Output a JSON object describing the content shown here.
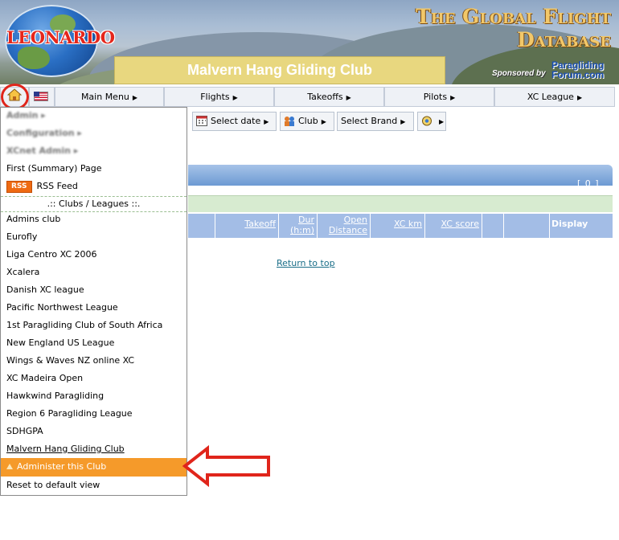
{
  "header": {
    "logo_text": "LEONARDO",
    "db_title": "The Global Flight Database",
    "club_name": "Malvern Hang Gliding Club",
    "sponsored_by": "Sponsored by",
    "sponsor_line1": "Paragliding",
    "sponsor_line2": "Forum.com"
  },
  "menubar": {
    "home_icon": "home-icon",
    "flag_icon": "us-flag-icon",
    "items": [
      {
        "label": "Main Menu"
      },
      {
        "label": "Flights"
      },
      {
        "label": "Takeoffs"
      },
      {
        "label": "Pilots"
      },
      {
        "label": "XC League"
      }
    ]
  },
  "toolbar": {
    "select_date": "Select date",
    "club": "Club",
    "select_brand": "Select Brand"
  },
  "table": {
    "count": "[ 0 ]",
    "columns": [
      "Takeoff",
      "Dur (h:m)",
      "Open Distance",
      "XC km",
      "XC score"
    ],
    "display_label": "Display",
    "return_to_top": "Return to top"
  },
  "dropdown": {
    "blurred": [
      "Admin",
      "Configuration",
      "XCnet Admin"
    ],
    "first_page": "First (Summary) Page",
    "rss_badge": "RSS",
    "rss_label": "RSS Feed",
    "separator": ".:: Clubs / Leagues ::.",
    "clubs": [
      "Admins club",
      "Eurofly",
      "Liga Centro XC 2006",
      "Xcalera",
      "Danish XC league",
      "Pacific Northwest League",
      "1st Paragliding Club of South Africa",
      "New England US League",
      "Wings & Waves NZ online XC",
      "XC Madeira Open",
      "Hawkwind Paragliding",
      "Region 6 Paragliding League",
      "SDHGPA",
      "Malvern Hang Gliding Club"
    ],
    "administer": "Administer this Club",
    "reset": "Reset to default view"
  },
  "colors": {
    "accent_orange": "#f59a2a",
    "callout_red": "#e0251b",
    "table_header_blue": "#a3bde6"
  }
}
